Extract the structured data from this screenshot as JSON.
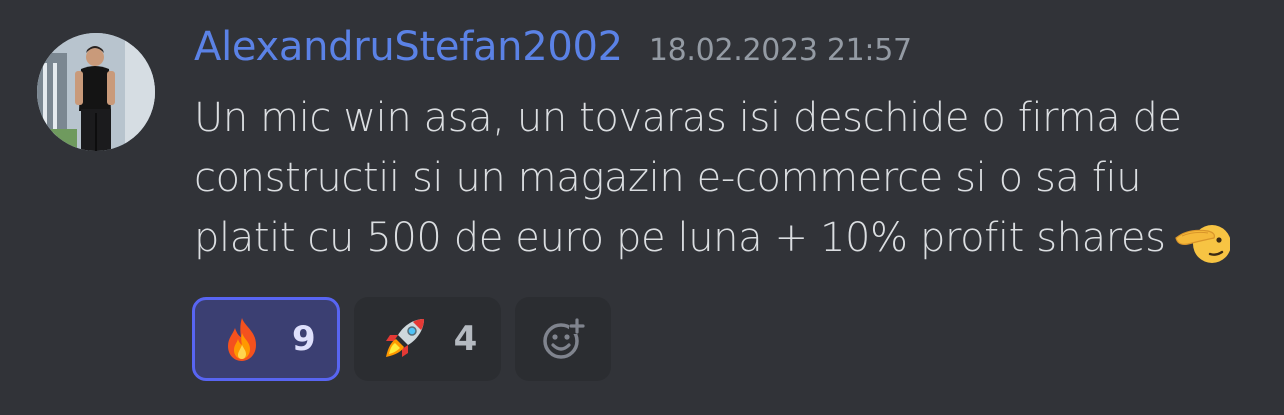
{
  "message": {
    "username": "AlexandruStefan2002",
    "timestamp": "18.02.2023 21:57",
    "content_lines": [
      "Un mic win asa, un tovaras isi deschide o firma de",
      "constructii si un magazin e-commerce si o sa fiu",
      "platit cu 500 de euro pe luna + 10% profit shares"
    ],
    "inline_emoji": "saluting-face-emoji",
    "avatar": "user-avatar-photo"
  },
  "reactions": [
    {
      "emoji": "fire-emoji",
      "count": "9",
      "active": true
    },
    {
      "emoji": "rocket-emoji",
      "count": "4",
      "active": false
    }
  ],
  "add_reaction": {
    "icon": "add-reaction-icon"
  },
  "colors": {
    "background": "#313338",
    "username": "#5b82e6",
    "timestamp": "#949ba4",
    "text": "#dbdee1",
    "reaction_bg": "#2b2d31",
    "reaction_active_bg": "#3b3f72",
    "reaction_active_border": "#5865f2"
  }
}
